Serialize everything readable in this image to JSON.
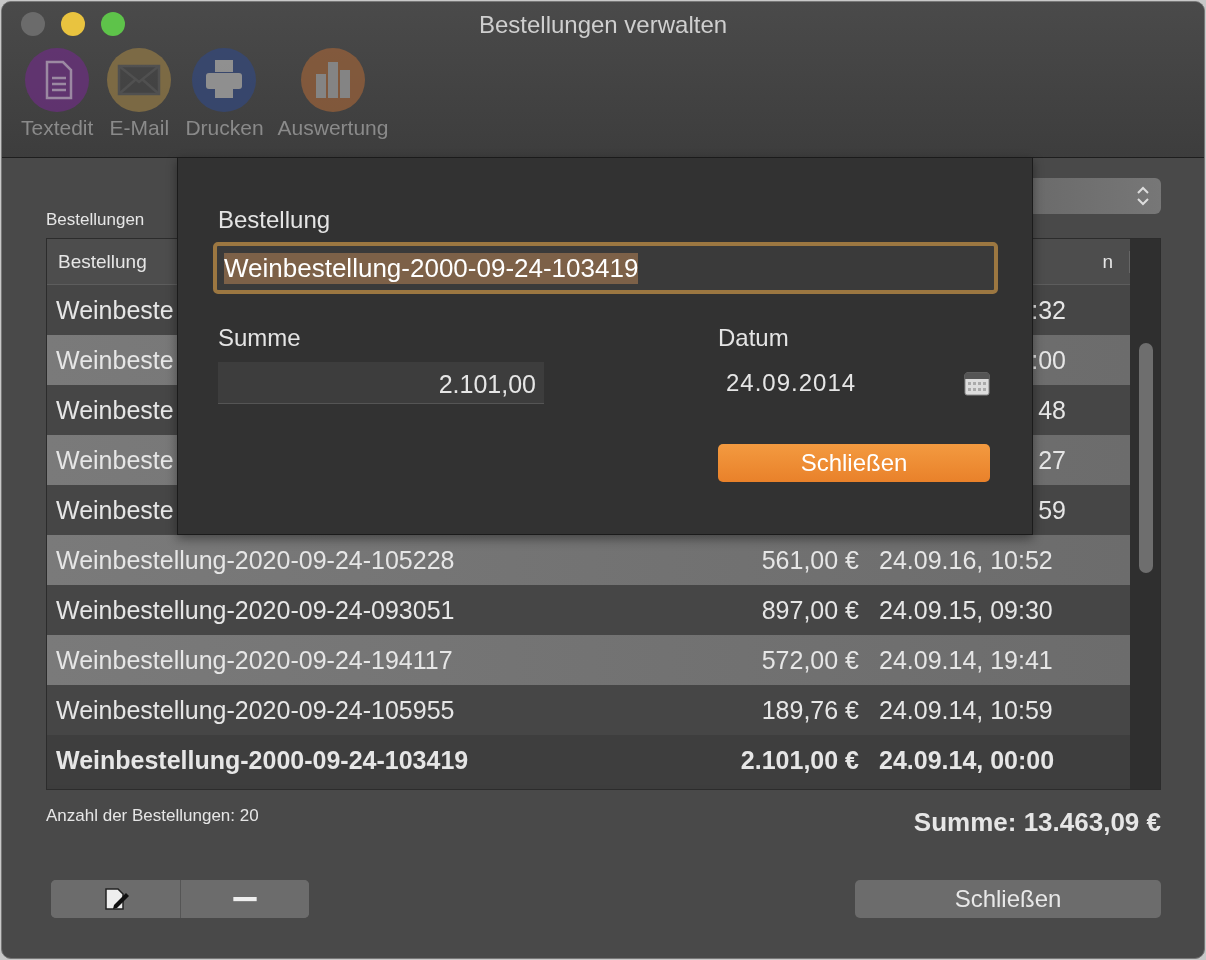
{
  "window": {
    "title": "Bestellungen verwalten"
  },
  "toolbar": [
    {
      "kind": "document",
      "label": "Textedit",
      "disabled": true
    },
    {
      "kind": "mail",
      "label": "E-Mail",
      "disabled": true
    },
    {
      "kind": "print",
      "label": "Drucken",
      "disabled": true
    },
    {
      "kind": "chart",
      "label": "Auswertung",
      "disabled": true
    }
  ],
  "list_label": "Bestellungen",
  "table": {
    "columns": {
      "column_1": "Bestellung",
      "column_3": "n"
    },
    "rows": [
      {
        "name": "Weinbeste",
        "date": ":32",
        "selected": false
      },
      {
        "name": "Weinbeste",
        "date": ":00",
        "selected": false
      },
      {
        "name": "Weinbeste",
        "date": "48",
        "selected": false
      },
      {
        "name": "Weinbeste",
        "date": "27",
        "selected": false
      },
      {
        "name": "Weinbeste",
        "date": "59",
        "selected": false
      },
      {
        "name": "Weinbestellung-2020-09-24-105228",
        "amount": "561,00 €",
        "date": "24.09.16, 10:52",
        "selected": false
      },
      {
        "name": "Weinbestellung-2020-09-24-093051",
        "amount": "897,00 €",
        "date": "24.09.15, 09:30",
        "selected": false
      },
      {
        "name": "Weinbestellung-2020-09-24-194117",
        "amount": "572,00 €",
        "date": "24.09.14, 19:41",
        "selected": false
      },
      {
        "name": "Weinbestellung-2020-09-24-105955",
        "amount": "189,76 €",
        "date": "24.09.14, 10:59",
        "selected": false
      },
      {
        "name": "Weinbestellung-2000-09-24-103419",
        "amount": "2.101,00 €",
        "date": "24.09.14, 00:00",
        "selected": true
      }
    ]
  },
  "footer": {
    "count": "Anzahl der Bestellungen: 20",
    "total": "Summe: 13.463,09 €",
    "close_button": "Schließen"
  },
  "sheet": {
    "name_label": "Bestellung",
    "name_value": "Weinbestellung-2000-09-24-103419",
    "sum_label": "Summe",
    "sum_value": "2.101,00",
    "date_label": "Datum",
    "date_value": "24.09.2014",
    "close_button": "Schließen"
  }
}
